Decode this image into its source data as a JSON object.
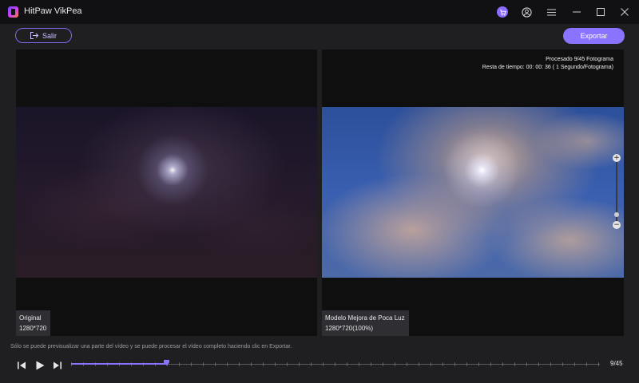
{
  "app": {
    "title": "HitPaw VikPea"
  },
  "window_controls": {
    "icons": [
      "cart-icon",
      "user-icon",
      "menu-icon",
      "minimize-icon",
      "maximize-icon",
      "close-icon"
    ]
  },
  "toolbar": {
    "exit_label": "Salir",
    "export_label": "Exportar"
  },
  "preview": {
    "original": {
      "name": "Original",
      "resolution": "1280*720"
    },
    "enhanced": {
      "name": "Modelo Mejora de Poca Luz",
      "resolution": "1280*720(100%)"
    },
    "processing": {
      "status": "Procesado 9/45 Fotograma",
      "time_left": "Resta de tiempo: 00: 00: 36 ( 1 Segundo/Fotograma)"
    },
    "zoom_in_glyph": "+",
    "zoom_out_glyph": "−"
  },
  "notice": "Sólo se puede previsualizar una parte del vídeo y se puede procesar el vídeo completo haciendo clic en Exportar.",
  "player": {
    "frame_label": "9/45",
    "progress": 0.18
  },
  "colors": {
    "accent": "#8a73ff",
    "background": "#1f1f22",
    "titlebar": "#111113"
  }
}
